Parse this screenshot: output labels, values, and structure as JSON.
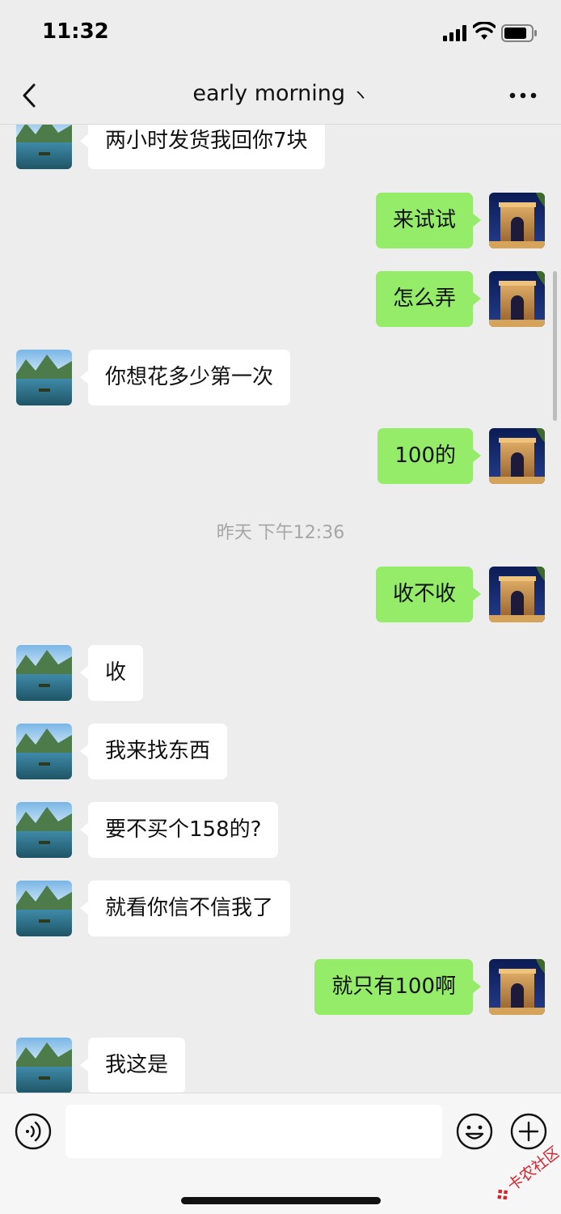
{
  "status_bar": {
    "time": "11:32"
  },
  "nav": {
    "title": "early morning",
    "title_suffix": "ヽ"
  },
  "messages": [
    {
      "side": "left",
      "text": "两小时发货我回你7块"
    },
    {
      "side": "right",
      "text": "来试试"
    },
    {
      "side": "right",
      "text": "怎么弄"
    },
    {
      "side": "left",
      "text": "你想花多少第一次"
    },
    {
      "side": "right",
      "text": "100的"
    },
    {
      "type": "timestamp",
      "text": "昨天 下午12:36"
    },
    {
      "side": "right",
      "text": "收不收"
    },
    {
      "side": "left",
      "text": "收"
    },
    {
      "side": "left",
      "text": "我来找东西"
    },
    {
      "side": "left",
      "text": "要不买个158的?"
    },
    {
      "side": "left",
      "text": "就看你信不信我了"
    },
    {
      "side": "right",
      "text": "就只有100啊"
    },
    {
      "side": "left",
      "text": "我这是"
    }
  ],
  "input_bar": {
    "text_value": ""
  },
  "watermark": {
    "text": "卡农社区"
  },
  "colors": {
    "sent_bubble": "#95ec69",
    "received_bubble": "#ffffff",
    "background": "#ededed"
  },
  "icons": {
    "left_avatar": "lake-landscape-avatar",
    "right_avatar": "arc-de-triomphe-avatar",
    "back": "chevron-left-icon",
    "more": "more-dots-icon",
    "voice": "voice-icon",
    "emoji": "emoji-icon",
    "plus": "plus-icon"
  }
}
